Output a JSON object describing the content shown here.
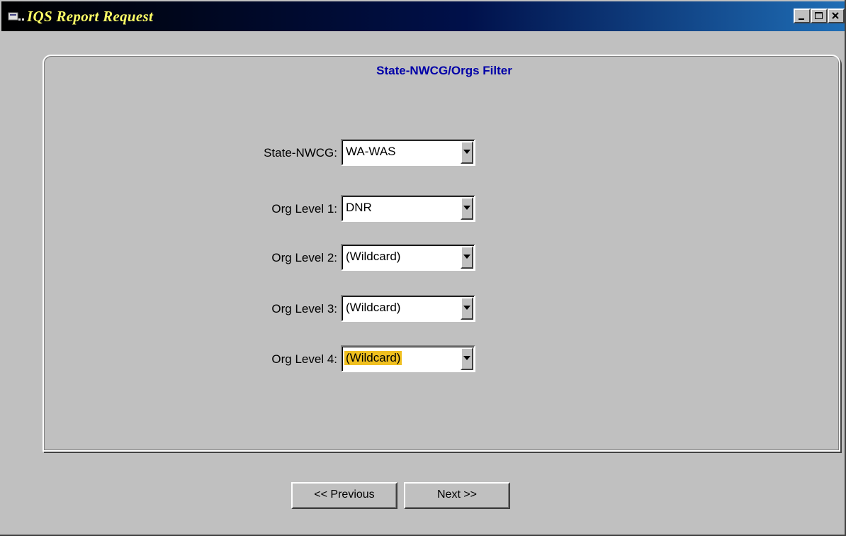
{
  "window": {
    "title": "IQS  Report Request",
    "icon": "app-icon",
    "controls": [
      "minimize-icon",
      "maximize-icon",
      "close-icon"
    ]
  },
  "panel": {
    "title": "State-NWCG/Orgs Filter"
  },
  "fields": [
    {
      "label": "State-NWCG:",
      "value": "WA-WAS"
    },
    {
      "label": "Org Level 1:",
      "value": "DNR"
    },
    {
      "label": "Org Level 2:",
      "value": "(Wildcard)"
    },
    {
      "label": "Org Level 3:",
      "value": "(Wildcard)"
    },
    {
      "label": "Org Level 4:",
      "value": "(Wildcard)",
      "highlight_color": "#f0c020"
    }
  ],
  "buttons": {
    "previous": "<< Previous",
    "next": "Next >>"
  },
  "colors": {
    "panel_title": "#0000a8",
    "title_text": "#ffff66",
    "selection": "#f0c020"
  }
}
